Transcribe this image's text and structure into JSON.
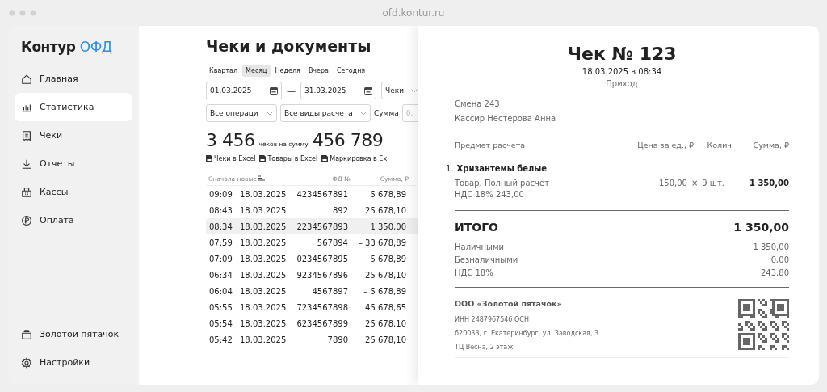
{
  "browser": {
    "url": "ofd.kontur.ru"
  },
  "sidebar": {
    "logo": {
      "name": "Контур",
      "accent": "ОФД"
    },
    "items": [
      {
        "label": "Главная",
        "selected": false
      },
      {
        "label": "Статистика",
        "selected": true
      },
      {
        "label": "Чеки",
        "selected": false
      },
      {
        "label": "Отчеты",
        "selected": false
      },
      {
        "label": "Кассы",
        "selected": false
      },
      {
        "label": "Оплата",
        "selected": false
      }
    ],
    "bottom_items": [
      {
        "label": "Золотой пятачок"
      },
      {
        "label": "Настройки"
      }
    ]
  },
  "main": {
    "title": "Чеки и документы",
    "periods": [
      {
        "label": "Квартал",
        "selected": false
      },
      {
        "label": "Месяц",
        "selected": true
      },
      {
        "label": "Неделя",
        "selected": false
      },
      {
        "label": "Вчера",
        "selected": false
      },
      {
        "label": "Сегодня",
        "selected": false
      }
    ],
    "date_from": "01.03.2025",
    "date_separator": "—",
    "date_to": "31.03.2025",
    "doc_type": "Чеки",
    "operations": "Все операци",
    "calc_types": "Все виды расчета",
    "sum_label": "Сумма",
    "sum_placeholder": "0,",
    "count": "3 456",
    "count_caption": "чеков на сумму",
    "total": "456 789",
    "exports": [
      "Чеки в Excel",
      "Товары в Excel",
      "Маркировка в Ex"
    ],
    "table": {
      "columns": [
        "Сначала новые",
        "ФД №",
        "Сумма, ₽"
      ],
      "rows": [
        {
          "time": "09:09",
          "date": "18.03.2025",
          "fd": "4234567891",
          "sum": "5 678,89",
          "selected": false
        },
        {
          "time": "08:43",
          "date": "18.03.2025",
          "fd": "892",
          "sum": "25 678,10",
          "selected": false
        },
        {
          "time": "08:34",
          "date": "18.03.2025",
          "fd": "2234567893",
          "sum": "1 350,00",
          "selected": true
        },
        {
          "time": "07:59",
          "date": "18.03.2025",
          "fd": "567894",
          "sum": "– 33 678,89",
          "selected": false
        },
        {
          "time": "07:09",
          "date": "18.03.2025",
          "fd": "0234567895",
          "sum": "5 678,89",
          "selected": false
        },
        {
          "time": "06:34",
          "date": "18.03.2025",
          "fd": "9234567896",
          "sum": "25 678,10",
          "selected": false
        },
        {
          "time": "06:04",
          "date": "18.03.2025",
          "fd": "4567897",
          "sum": "– 5 678,89",
          "selected": false
        },
        {
          "time": "05:55",
          "date": "18.03.2025",
          "fd": "7234567898",
          "sum": "45 678,65",
          "selected": false
        },
        {
          "time": "05:54",
          "date": "18.03.2025",
          "fd": "6234567899",
          "sum": "25 678,10",
          "selected": false
        },
        {
          "time": "05:42",
          "date": "18.03.2025",
          "fd": "7890",
          "sum": "25 678,10",
          "selected": false
        }
      ]
    }
  },
  "receipt": {
    "title": "Чек № 123",
    "datetime": "18.03.2025 в 08:34",
    "type": "Приход",
    "shift": "Смена 243",
    "cashier": "Кассир Нестерова Анна",
    "columns": [
      "Предмет расчета",
      "Цена за ед., ₽",
      "Колич.",
      "Сумма, ₽"
    ],
    "items": [
      {
        "number": "1.",
        "name": "Хризантемы белые",
        "description": "Товар. Полный расчет",
        "vat": "НДС 18% 243,00",
        "price": "150,00",
        "times": "×",
        "quantity": "9 шт.",
        "sum": "1 350,00"
      }
    ],
    "total_label": "ИТОГО",
    "total": "1 350,00",
    "payments": [
      {
        "label": "Наличными",
        "value": "1 350,00"
      },
      {
        "label": "Безналичными",
        "value": "0,00"
      },
      {
        "label": "НДС 18%",
        "value": "243,80"
      }
    ],
    "org": {
      "name": "ООО «Золотой пятачок»",
      "inn": "ИНН 2487967546 ОСН",
      "address": "620033, г. Екатеринбург, ул. Заводская, 3",
      "place": "ТЦ Весна, 2 этаж"
    }
  }
}
